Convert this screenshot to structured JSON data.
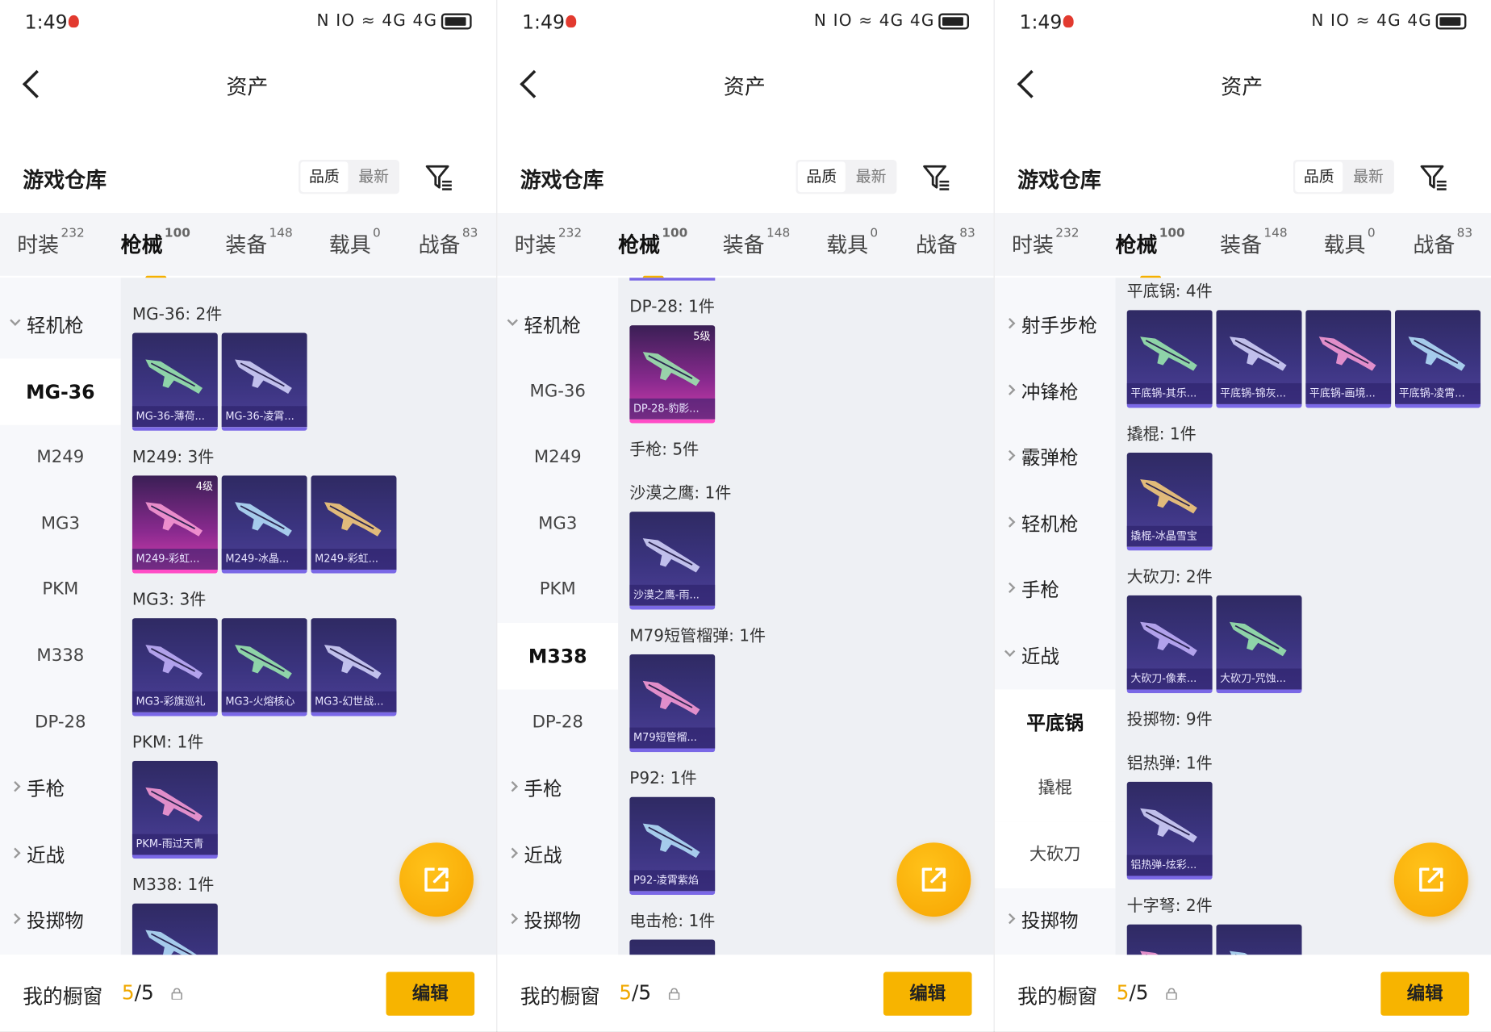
{
  "status": {
    "time": "1:49",
    "icons": "N IO ≈ 4G 4G"
  },
  "title": "资产",
  "warehouse_title": "游戏仓库",
  "sort_options": [
    "品质",
    "最新"
  ],
  "tabs": [
    {
      "label": "时装",
      "count": "232"
    },
    {
      "label": "枪械",
      "count": "100"
    },
    {
      "label": "装备",
      "count": "148"
    },
    {
      "label": "载具",
      "count": "0"
    },
    {
      "label": "战备",
      "count": "83"
    }
  ],
  "bottom": {
    "label": "我的橱窗",
    "count_current": "5",
    "count_total": "/5",
    "edit_label": "编辑"
  },
  "colors": {
    "accent": "#f7b400",
    "card_purple": "#3b3480",
    "card_pink": "#d13dab"
  },
  "panels": [
    {
      "sidebar": [
        {
          "label": "轻机枪",
          "kind": "cat",
          "open": true
        },
        {
          "label": "MG-36",
          "kind": "sub",
          "selected": true
        },
        {
          "label": "M249",
          "kind": "sub"
        },
        {
          "label": "MG3",
          "kind": "sub"
        },
        {
          "label": "PKM",
          "kind": "sub"
        },
        {
          "label": "M338",
          "kind": "sub"
        },
        {
          "label": "DP-28",
          "kind": "sub"
        },
        {
          "label": "手枪",
          "kind": "cat"
        },
        {
          "label": "近战",
          "kind": "cat"
        },
        {
          "label": "投掷物",
          "kind": "cat"
        }
      ],
      "groups": [
        {
          "title": "MG-36: 2件",
          "items": [
            {
              "name": "MG-36-薄荷...",
              "pink": false
            },
            {
              "name": "MG-36-凌霄...",
              "pink": false
            }
          ]
        },
        {
          "title": "M249: 3件",
          "items": [
            {
              "name": "M249-彩虹...",
              "pink": true,
              "level": "4级"
            },
            {
              "name": "M249-冰晶...",
              "pink": false
            },
            {
              "name": "M249-彩虹...",
              "pink": false
            }
          ]
        },
        {
          "title": "MG3: 3件",
          "items": [
            {
              "name": "MG3-彩旗巡礼",
              "pink": false
            },
            {
              "name": "MG3-火熔核心",
              "pink": false
            },
            {
              "name": "MG3-幻世战...",
              "pink": false
            }
          ]
        },
        {
          "title": "PKM: 1件",
          "items": [
            {
              "name": "PKM-雨过天青",
              "pink": false
            }
          ]
        },
        {
          "title": "M338: 1件",
          "items": [
            {
              "name": "",
              "pink": false
            }
          ]
        }
      ]
    },
    {
      "sidebar": [
        {
          "label": "轻机枪",
          "kind": "cat",
          "open": true
        },
        {
          "label": "MG-36",
          "kind": "sub"
        },
        {
          "label": "M249",
          "kind": "sub"
        },
        {
          "label": "MG3",
          "kind": "sub"
        },
        {
          "label": "PKM",
          "kind": "sub"
        },
        {
          "label": "M338",
          "kind": "sub",
          "selected": true
        },
        {
          "label": "DP-28",
          "kind": "sub"
        },
        {
          "label": "手枪",
          "kind": "cat"
        },
        {
          "label": "近战",
          "kind": "cat"
        },
        {
          "label": "投掷物",
          "kind": "cat"
        }
      ],
      "groups": [
        {
          "title": "DP-28: 1件",
          "items": [
            {
              "name": "DP-28-豹影...",
              "pink": true,
              "level": "5级"
            }
          ]
        },
        {
          "title": "手枪: 5件",
          "items": []
        },
        {
          "title": "沙漠之鹰: 1件",
          "items": [
            {
              "name": "沙漠之鹰-雨...",
              "pink": false
            }
          ]
        },
        {
          "title": "M79短管榴弹: 1件",
          "items": [
            {
              "name": "M79短管榴...",
              "pink": false
            }
          ]
        },
        {
          "title": "P92: 1件",
          "items": [
            {
              "name": "P92-凌霄紫焰",
              "pink": false
            }
          ]
        },
        {
          "title": "电击枪: 1件",
          "items": [
            {
              "name": "",
              "pink": false
            }
          ]
        }
      ]
    },
    {
      "sidebar": [
        {
          "label": "射手步枪",
          "kind": "cat"
        },
        {
          "label": "冲锋枪",
          "kind": "cat"
        },
        {
          "label": "霰弹枪",
          "kind": "cat"
        },
        {
          "label": "轻机枪",
          "kind": "cat"
        },
        {
          "label": "手枪",
          "kind": "cat"
        },
        {
          "label": "近战",
          "kind": "cat",
          "open": true
        },
        {
          "label": "平底锅",
          "kind": "sub",
          "selected": true
        },
        {
          "label": "撬棍",
          "kind": "sub"
        },
        {
          "label": "大砍刀",
          "kind": "sub"
        },
        {
          "label": "投掷物",
          "kind": "cat"
        }
      ],
      "groups": [
        {
          "title": "平底锅: 4件",
          "items": [
            {
              "name": "平底锅-其乐...",
              "pink": false
            },
            {
              "name": "平底锅-锦灰...",
              "pink": false
            },
            {
              "name": "平底锅-画境...",
              "pink": false
            },
            {
              "name": "平底锅-凌霄...",
              "pink": false
            }
          ]
        },
        {
          "title": "撬棍: 1件",
          "items": [
            {
              "name": "撬棍-冰晶雪宝",
              "pink": false
            }
          ]
        },
        {
          "title": "大砍刀: 2件",
          "items": [
            {
              "name": "大砍刀-像素...",
              "pink": false
            },
            {
              "name": "大砍刀-咒蚀...",
              "pink": false
            }
          ]
        },
        {
          "title": "投掷物: 9件",
          "items": []
        },
        {
          "title": "铝热弹: 1件",
          "items": [
            {
              "name": "铝热弹-炫彩...",
              "pink": false
            }
          ]
        },
        {
          "title": "十字弩: 2件",
          "items": [
            {
              "name": "",
              "pink": false
            },
            {
              "name": "",
              "pink": false
            }
          ]
        }
      ]
    }
  ]
}
